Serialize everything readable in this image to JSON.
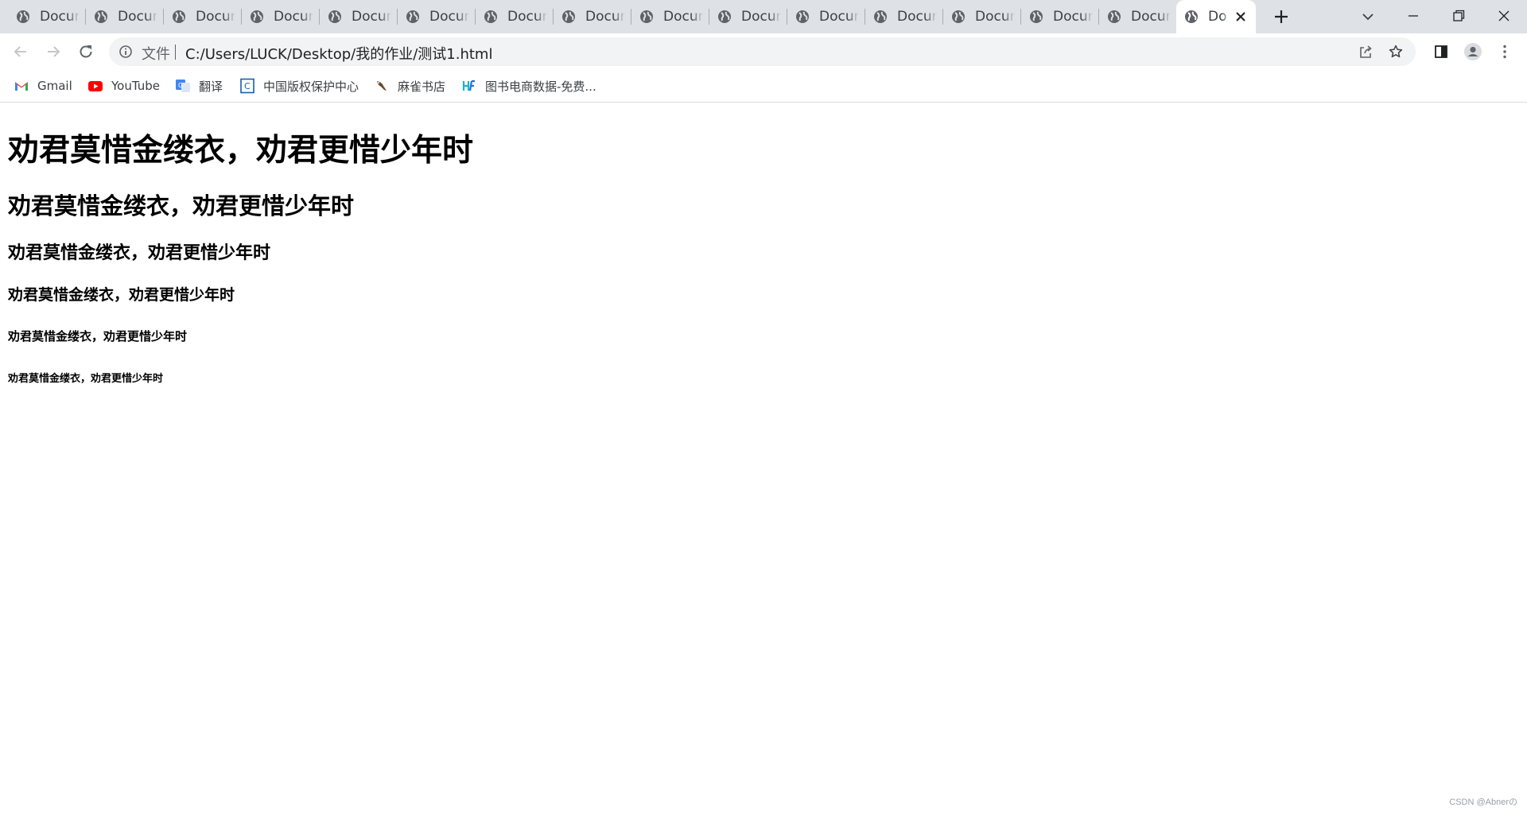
{
  "tabs": [
    {
      "title": "Docun"
    },
    {
      "title": "Docun"
    },
    {
      "title": "Docun"
    },
    {
      "title": "Docun"
    },
    {
      "title": "Docun"
    },
    {
      "title": "Docun"
    },
    {
      "title": "Docun"
    },
    {
      "title": "Docun"
    },
    {
      "title": "Docun"
    },
    {
      "title": "Docun"
    },
    {
      "title": "Docun"
    },
    {
      "title": "Docun"
    },
    {
      "title": "Docun"
    },
    {
      "title": "Docun"
    },
    {
      "title": "Docun"
    }
  ],
  "active_tab": {
    "title": "Do"
  },
  "omnibox": {
    "scheme_label": "文件",
    "url": "C:/Users/LUCK/Desktop/我的作业/测试1.html"
  },
  "bookmarks": [
    {
      "label": "Gmail",
      "icon": "gmail-icon"
    },
    {
      "label": "YouTube",
      "icon": "youtube-icon"
    },
    {
      "label": "翻译",
      "icon": "translate-icon"
    },
    {
      "label": "中国版权保护中心",
      "icon": "copyright-center-icon"
    },
    {
      "label": "麻雀书店",
      "icon": "sparrow-icon"
    },
    {
      "label": "图书电商数据-免费...",
      "icon": "book-data-icon"
    }
  ],
  "page": {
    "h1": "劝君莫惜金缕衣，劝君更惜少年时",
    "h2": "劝君莫惜金缕衣，劝君更惜少年时",
    "h3": "劝君莫惜金缕衣，劝君更惜少年时",
    "h4": "劝君莫惜金缕衣，劝君更惜少年时",
    "h5": "劝君莫惜金缕衣，劝君更惜少年时",
    "h6": "劝君莫惜金缕衣，劝君更惜少年时"
  },
  "watermark": "CSDN @Abnerの",
  "colors": {
    "tabstrip_bg": "#dee1e6",
    "omnibox_bg": "#f1f3f4",
    "text": "#000000",
    "youtube_red": "#ff0000",
    "gmail_red": "#ea4335"
  }
}
